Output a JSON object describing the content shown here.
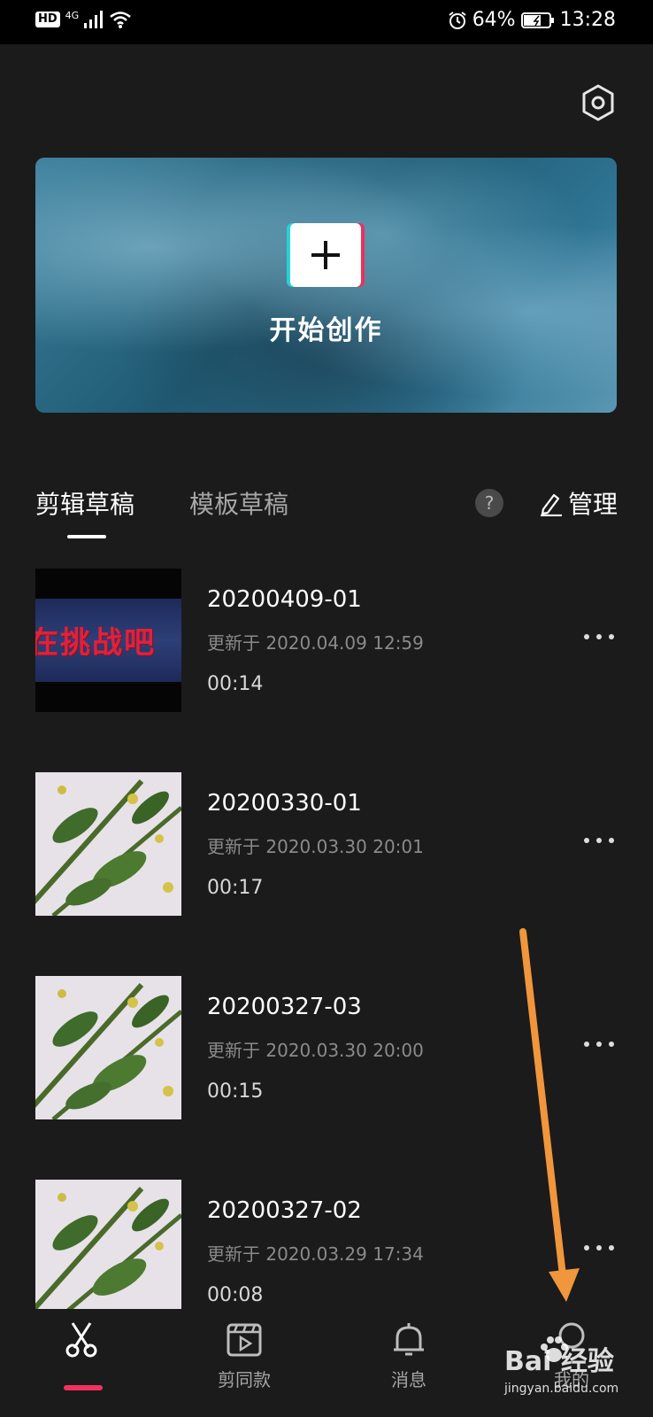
{
  "status_bar": {
    "hd": "HD",
    "network": "4G",
    "battery": "64%",
    "time": "13:28"
  },
  "banner": {
    "title": "开始创作"
  },
  "tabs": {
    "drafts": "剪辑草稿",
    "templates": "模板草稿",
    "help": "?",
    "manage": "管理"
  },
  "drafts": [
    {
      "title": "20200409-01",
      "updated": "更新于 2020.04.09 12:59",
      "duration": "00:14",
      "thumb_caption": "在挑战吧"
    },
    {
      "title": "20200330-01",
      "updated": "更新于 2020.03.30 20:01",
      "duration": "00:17"
    },
    {
      "title": "20200327-03",
      "updated": "更新于 2020.03.30 20:00",
      "duration": "00:15"
    },
    {
      "title": "20200327-02",
      "updated": "更新于 2020.03.29 17:34",
      "duration": "00:08"
    }
  ],
  "tabbar": {
    "edit_icon": "scissors-icon",
    "template_label": "剪同款",
    "messages_label": "消息",
    "me_label": "我的"
  },
  "watermark": {
    "text": "Bai 经验",
    "url": "jingyan.baidu.com"
  },
  "colors": {
    "accent": "#f2325d",
    "background": "#1b1b1b",
    "annotation_arrow": "#f0963c"
  }
}
